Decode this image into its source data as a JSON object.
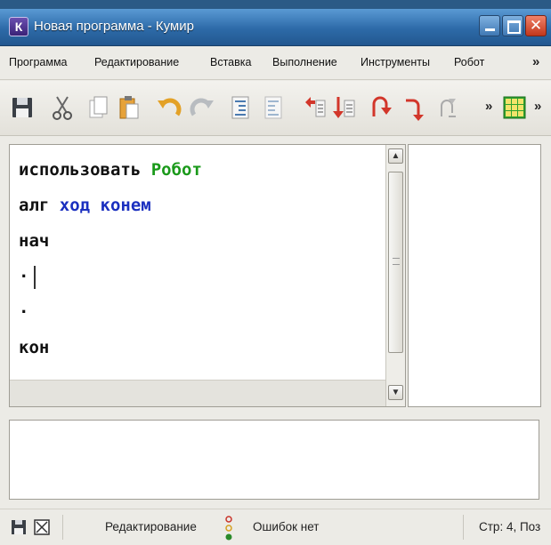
{
  "window": {
    "title": "Новая программа - Кумир",
    "icon_letter": "К"
  },
  "menu": {
    "items": [
      "Программа",
      "Редактирование",
      "Вставка",
      "Выполнение",
      "Инструменты",
      "Робот"
    ],
    "more": "»"
  },
  "toolbar": {
    "buttons": [
      "save-icon",
      "cut-icon",
      "copy-icon",
      "paste-icon",
      "undo-icon",
      "redo-icon",
      "indent-icon",
      "unindent-icon",
      "run-icon",
      "step-icon",
      "step-into-icon",
      "step-out-icon",
      "stop-icon",
      "robot-field-icon"
    ],
    "more_label": "»"
  },
  "editor": {
    "lines": [
      {
        "segments": [
          {
            "text": "использовать ",
            "style": "normal"
          },
          {
            "text": "Робот",
            "style": "green"
          }
        ]
      },
      {
        "segments": [
          {
            "text": "алг ",
            "style": "normal"
          },
          {
            "text": "ход конем",
            "style": "blue"
          }
        ]
      },
      {
        "segments": [
          {
            "text": "нач",
            "style": "normal"
          }
        ]
      },
      {
        "segments": [
          {
            "text": "·",
            "style": "normal"
          }
        ]
      },
      {
        "segments": [
          {
            "text": "·",
            "style": "normal"
          }
        ]
      },
      {
        "segments": [
          {
            "text": "кон",
            "style": "normal"
          }
        ]
      }
    ],
    "colors": {
      "keyword_green": "#1a9a1a",
      "keyword_blue": "#1a2fbf"
    }
  },
  "status": {
    "mode": "Редактирование",
    "errors": "Ошибок нет",
    "position": "Стр: 4, Поз"
  }
}
